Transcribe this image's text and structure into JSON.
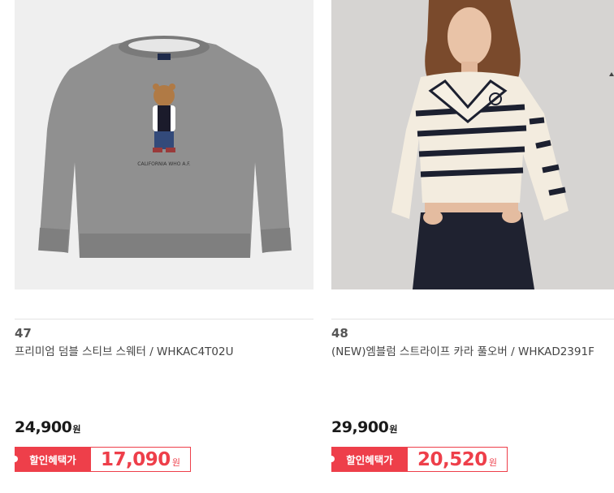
{
  "products": [
    {
      "rank": "47",
      "name": "프리미엄 덤블 스티브 스웨터 / WHKAC4T02U",
      "price": "24,900",
      "currency": "원",
      "benefit_label": "할인혜택가",
      "benefit_price": "17,090",
      "benefit_currency": "원",
      "image_icon": "grey-sweater-bear-image"
    },
    {
      "rank": "48",
      "name": "(NEW)엠블럼 스트라이프 카라 풀오버 / WHKAD2391F",
      "price": "29,900",
      "currency": "원",
      "benefit_label": "할인혜택가",
      "benefit_price": "20,520",
      "benefit_currency": "원",
      "image_icon": "model-striped-pullover-image"
    }
  ],
  "colors": {
    "accent": "#ee3f4a",
    "text": "#222222",
    "muted": "#555555"
  }
}
